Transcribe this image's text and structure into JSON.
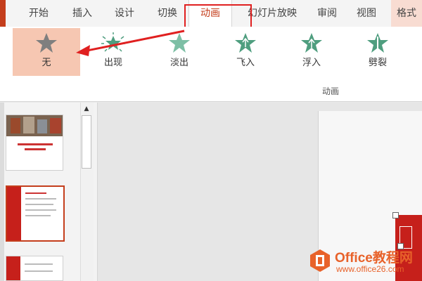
{
  "tabs": [
    "开始",
    "插入",
    "设计",
    "切换",
    "动画",
    "幻灯片放映",
    "审阅",
    "视图",
    "格式"
  ],
  "active_tab": "动画",
  "effects": [
    {
      "label": "无",
      "icon": "star-none-icon",
      "selected": true
    },
    {
      "label": "出现",
      "icon": "star-appear-icon"
    },
    {
      "label": "淡出",
      "icon": "star-fade-icon"
    },
    {
      "label": "飞入",
      "icon": "star-fly-in-icon"
    },
    {
      "label": "浮入",
      "icon": "star-float-in-icon"
    },
    {
      "label": "劈裂",
      "icon": "star-split-icon"
    }
  ],
  "group_label": "动画",
  "watermark": {
    "brand": "Office教程网",
    "url": "www.office26.com"
  },
  "colors": {
    "accent": "#c43e1c",
    "highlight": "#e02020",
    "selected_bg": "#f6c7b2",
    "star_green": "#4f9e7f",
    "star_gray": "#7f7f7f"
  }
}
